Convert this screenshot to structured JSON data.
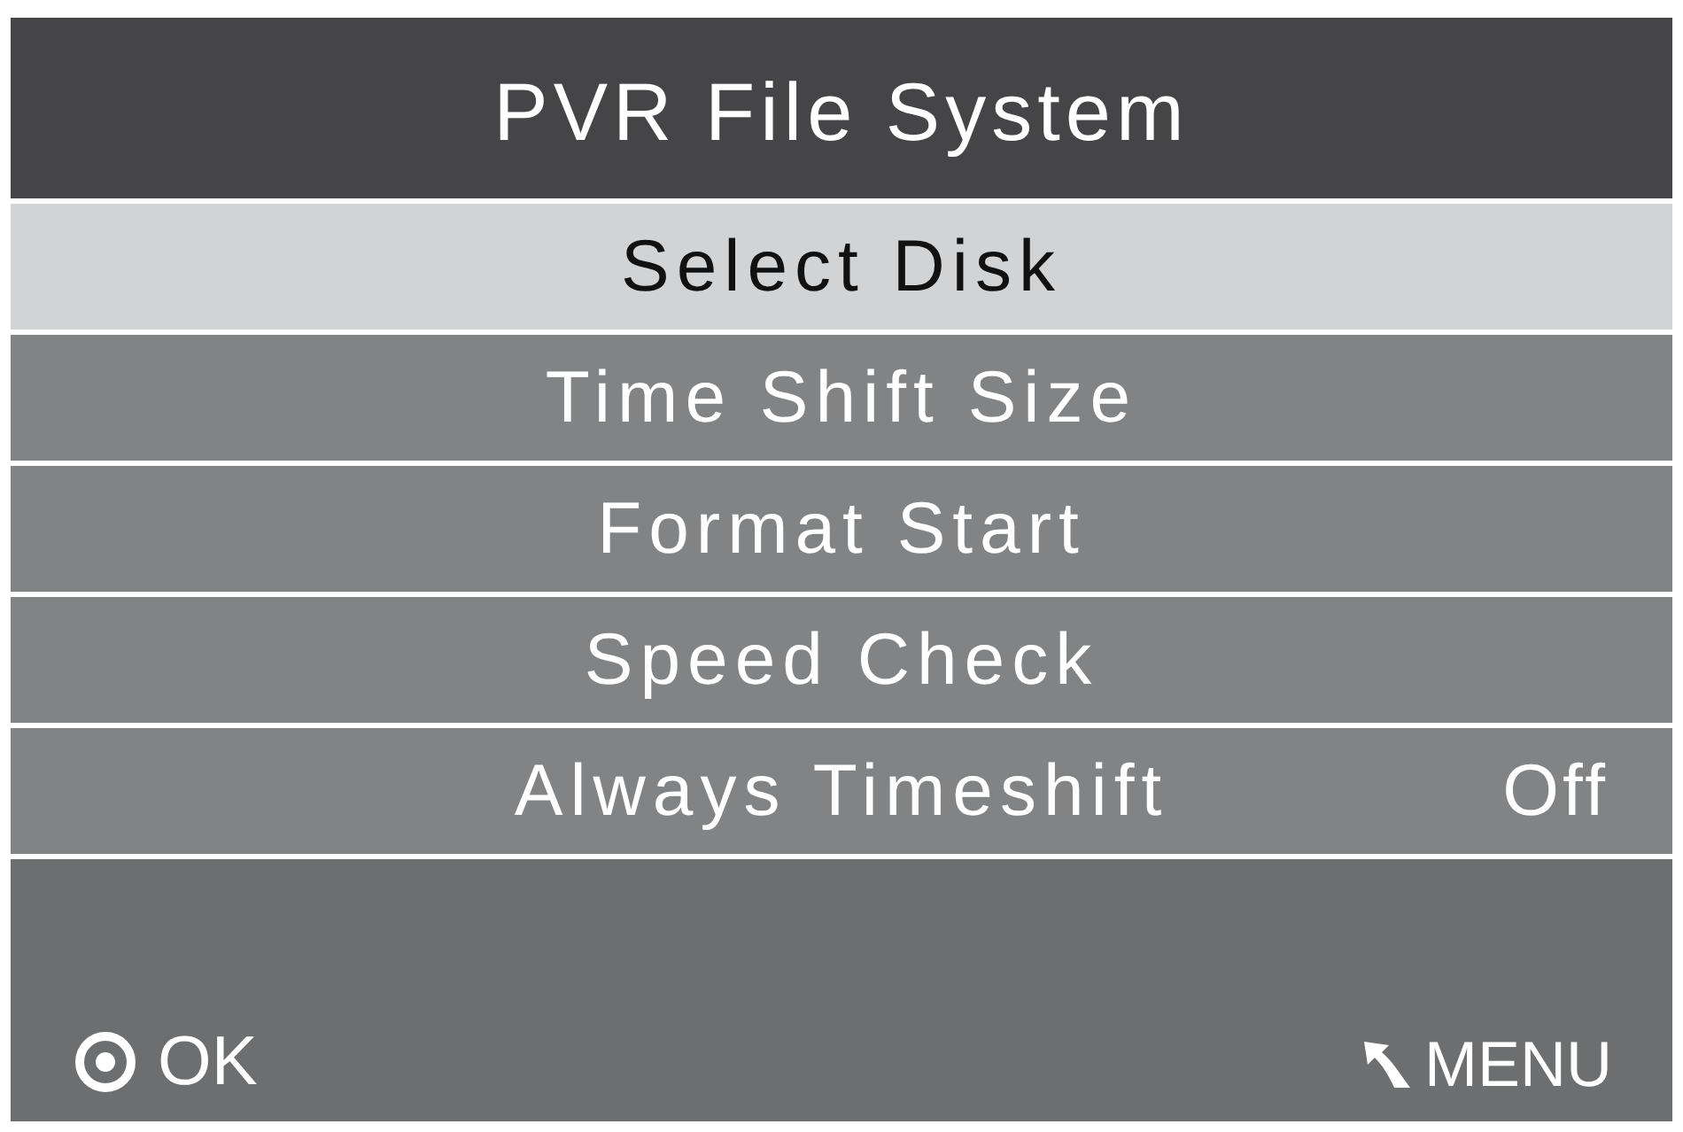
{
  "title": "PVR File System",
  "menu_items": [
    {
      "label": "Select Disk",
      "selected": true
    },
    {
      "label": "Time Shift Size",
      "selected": false
    },
    {
      "label": "Format Start",
      "selected": false
    },
    {
      "label": "Speed Check",
      "selected": false
    },
    {
      "label": "Always Timeshift",
      "value": "Off",
      "selected": false
    }
  ],
  "footer": {
    "ok_hint": "OK",
    "menu_hint": "MENU"
  }
}
